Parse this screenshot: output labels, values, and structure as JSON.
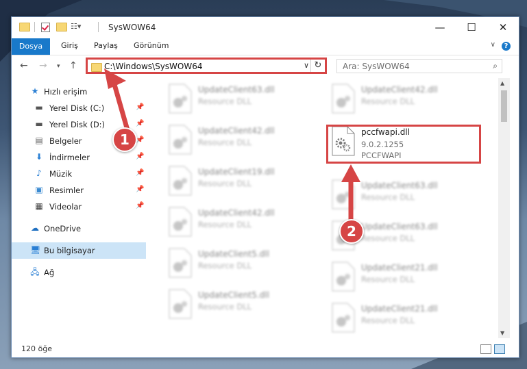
{
  "window": {
    "title": "SysWOW64",
    "controls": {
      "minimize": "—",
      "maximize": "☐",
      "close": "✕"
    }
  },
  "ribbon": {
    "tabs": [
      "Dosya",
      "Giriş",
      "Paylaş",
      "Görünüm"
    ],
    "help": "?"
  },
  "navigation": {
    "address": "C:\\Windows\\SysWOW64",
    "search_placeholder": "Ara: SysWOW64"
  },
  "sidebar": {
    "quick_access": "Hızlı erişim",
    "items": [
      {
        "label": "Yerel Disk (C:)",
        "icon": "drive-icon",
        "pinned": true
      },
      {
        "label": "Yerel Disk (D:)",
        "icon": "drive-icon",
        "pinned": true
      },
      {
        "label": "Belgeler",
        "icon": "documents-icon",
        "pinned": true
      },
      {
        "label": "İndirmeler",
        "icon": "downloads-icon",
        "pinned": true
      },
      {
        "label": "Müzik",
        "icon": "music-icon",
        "pinned": true
      },
      {
        "label": "Resimler",
        "icon": "pictures-icon",
        "pinned": true
      },
      {
        "label": "Videolar",
        "icon": "videos-icon",
        "pinned": true
      }
    ],
    "onedrive": "OneDrive",
    "this_pc": "Bu bilgisayar",
    "network": "Ağ"
  },
  "files": {
    "left": [
      {
        "name": "UpdateClient63.dll",
        "type": "Resource DLL"
      },
      {
        "name": "UpdateClient42.dll",
        "type": "Resource DLL"
      },
      {
        "name": "UpdateClient19.dll",
        "type": "Resource DLL"
      },
      {
        "name": "UpdateClient42.dll",
        "type": "Resource DLL"
      },
      {
        "name": "UpdateClient5.dll",
        "type": "Resource DLL"
      },
      {
        "name": "UpdateClient5.dll",
        "type": "Resource DLL"
      }
    ],
    "right": [
      {
        "name": "UpdateClient42.dll",
        "type": "Resource DLL"
      },
      {
        "name": "pccfwapi.dll",
        "version": "9.0.2.1255",
        "type": "PCCFWAPI"
      },
      {
        "name": "UpdateClient63.dll",
        "type": "Resource DLL"
      },
      {
        "name": "UpdateClient63.dll",
        "type": "Resource DLL"
      },
      {
        "name": "UpdateClient21.dll",
        "type": "Resource DLL"
      },
      {
        "name": "UpdateClient21.dll",
        "type": "Resource DLL"
      }
    ]
  },
  "status": {
    "item_count": "120 öğe"
  },
  "annotations": {
    "step1": "1",
    "step2": "2",
    "color": "#d64545"
  }
}
